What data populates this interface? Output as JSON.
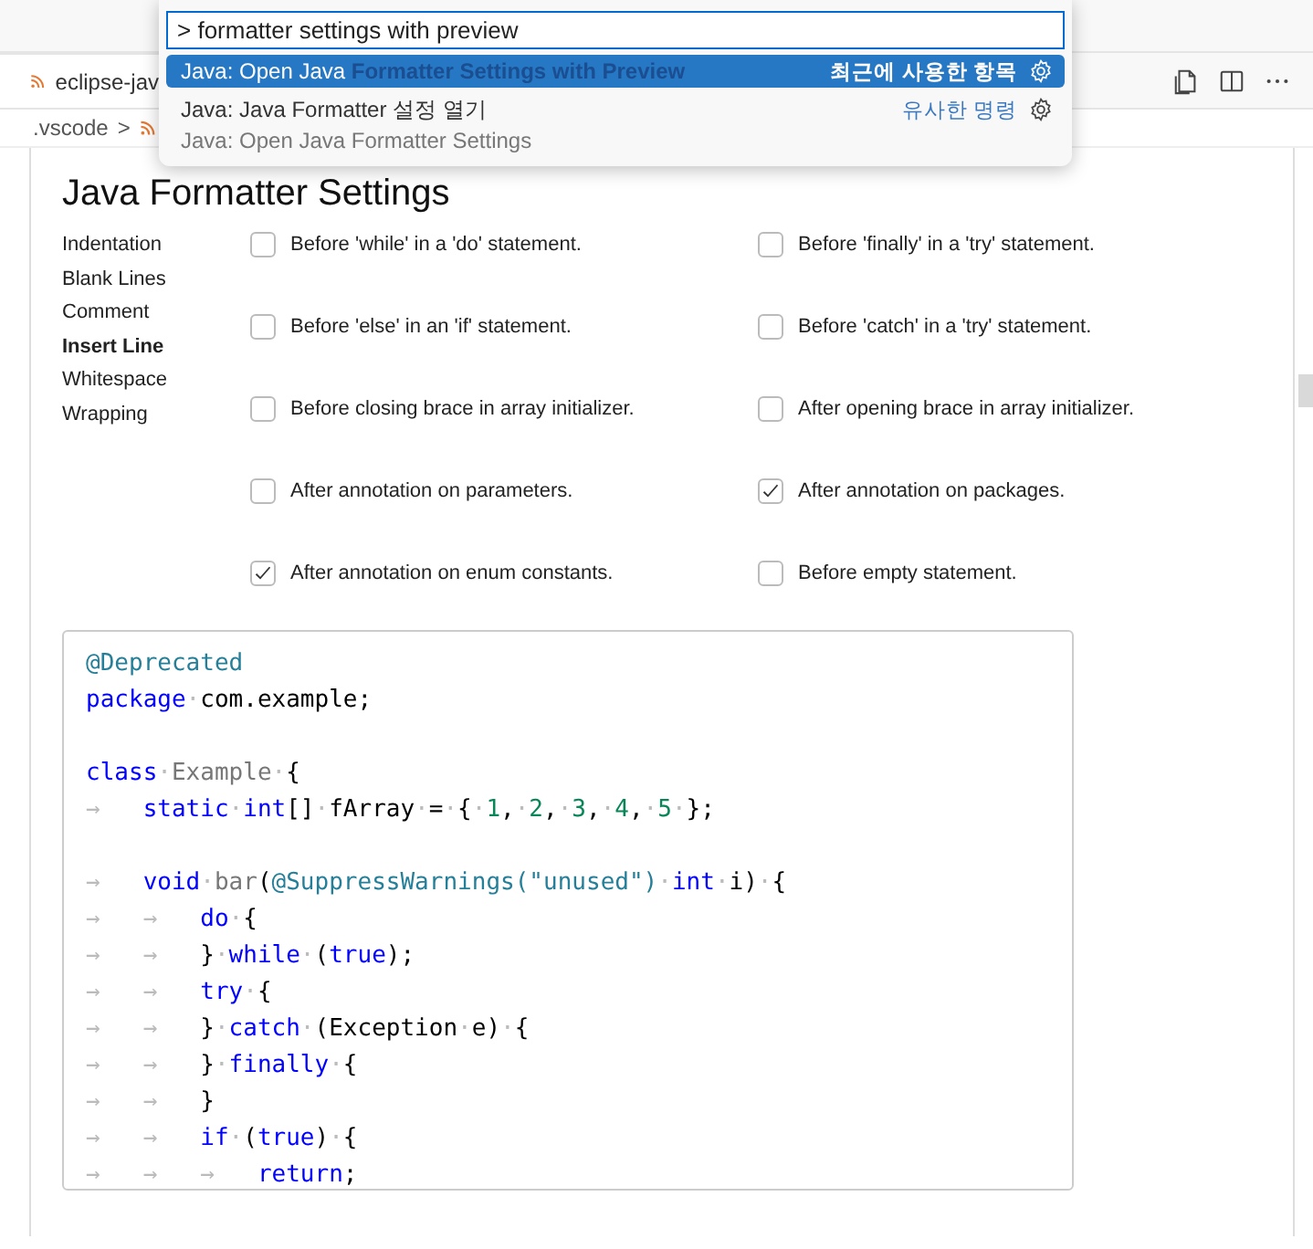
{
  "tab": {
    "title": "eclipse-jav"
  },
  "breadcrumb": {
    "folder": ".vscode",
    "separator": ">"
  },
  "palette": {
    "value": "> formatter settings with preview",
    "items": [
      {
        "label": "Java: Open Java **Formatter Settings with Preview**",
        "tag": "최근에 사용한 항목",
        "selected": true
      },
      {
        "label": "Java: Java Formatter 설정 열기",
        "tag": "유사한 명령",
        "detail": "Java: Open Java Formatter Settings",
        "selected": false
      }
    ]
  },
  "page": {
    "title": "Java Formatter Settings",
    "sections": [
      {
        "label": "Indentation",
        "selected": false
      },
      {
        "label": "Blank Lines",
        "selected": false
      },
      {
        "label": "Comment",
        "selected": false
      },
      {
        "label": "Insert Line",
        "selected": true
      },
      {
        "label": "Whitespace",
        "selected": false
      },
      {
        "label": "Wrapping",
        "selected": false
      }
    ],
    "options": [
      {
        "label": "Before 'while' in a 'do' statement.",
        "checked": false
      },
      {
        "label": "Before 'finally' in a 'try' statement.",
        "checked": false
      },
      {
        "label": "Before 'else' in an 'if' statement.",
        "checked": false
      },
      {
        "label": "Before 'catch' in a 'try' statement.",
        "checked": false
      },
      {
        "label": "Before closing brace in array initializer.",
        "checked": false
      },
      {
        "label": "After opening brace in array initializer.",
        "checked": false
      },
      {
        "label": "After annotation on parameters.",
        "checked": false
      },
      {
        "label": "After annotation on packages.",
        "checked": true
      },
      {
        "label": "After annotation on enum constants.",
        "checked": true
      },
      {
        "label": "Before empty statement.",
        "checked": false
      }
    ],
    "preview": [
      {
        "kind": "code",
        "tokens": [
          {
            "kind": "annotation",
            "text": "@Deprecated"
          }
        ]
      },
      {
        "kind": "code",
        "tokens": [
          {
            "kind": "keyword",
            "text": "package"
          },
          {
            "kind": "plain",
            "text": "·com.example;"
          }
        ]
      },
      {
        "kind": "blank"
      },
      {
        "kind": "code",
        "tokens": [
          {
            "kind": "keyword",
            "text": "class"
          },
          {
            "kind": "plain",
            "text": "·"
          },
          {
            "kind": "name",
            "text": "Example"
          },
          {
            "kind": "plain",
            "text": "·{"
          }
        ]
      },
      {
        "kind": "code",
        "tokens": [
          {
            "kind": "plain",
            "text": "→   "
          },
          {
            "kind": "keyword",
            "text": "static"
          },
          {
            "kind": "plain",
            "text": "·"
          },
          {
            "kind": "keyword",
            "text": "int"
          },
          {
            "kind": "plain",
            "text": "[]·fArray·=·{·"
          },
          {
            "kind": "number",
            "text": "1"
          },
          {
            "kind": "plain",
            "text": ",·"
          },
          {
            "kind": "number",
            "text": "2"
          },
          {
            "kind": "plain",
            "text": ",·"
          },
          {
            "kind": "number",
            "text": "3"
          },
          {
            "kind": "plain",
            "text": ",·"
          },
          {
            "kind": "number",
            "text": "4"
          },
          {
            "kind": "plain",
            "text": ",·"
          },
          {
            "kind": "number",
            "text": "5"
          },
          {
            "kind": "plain",
            "text": "·};"
          }
        ]
      },
      {
        "kind": "blank"
      },
      {
        "kind": "code",
        "tokens": [
          {
            "kind": "plain",
            "text": "→   "
          },
          {
            "kind": "keyword",
            "text": "void"
          },
          {
            "kind": "plain",
            "text": "·"
          },
          {
            "kind": "name",
            "text": "bar"
          },
          {
            "kind": "plain",
            "text": "("
          },
          {
            "kind": "annotation",
            "text": "@SuppressWarnings(\"unused\")"
          },
          {
            "kind": "plain",
            "text": "·"
          },
          {
            "kind": "keyword",
            "text": "int"
          },
          {
            "kind": "plain",
            "text": "·i)·{"
          }
        ]
      },
      {
        "kind": "code",
        "tokens": [
          {
            "kind": "plain",
            "text": "→   →   "
          },
          {
            "kind": "keyword",
            "text": "do"
          },
          {
            "kind": "plain",
            "text": "·{"
          }
        ]
      },
      {
        "kind": "code",
        "tokens": [
          {
            "kind": "plain",
            "text": "→   →   }·"
          },
          {
            "kind": "keyword",
            "text": "while"
          },
          {
            "kind": "plain",
            "text": "·("
          },
          {
            "kind": "keyword",
            "text": "true"
          },
          {
            "kind": "plain",
            "text": ");"
          }
        ]
      },
      {
        "kind": "code",
        "tokens": [
          {
            "kind": "plain",
            "text": "→   →   "
          },
          {
            "kind": "keyword",
            "text": "try"
          },
          {
            "kind": "plain",
            "text": "·{"
          }
        ]
      },
      {
        "kind": "code",
        "tokens": [
          {
            "kind": "plain",
            "text": "→   →   }·"
          },
          {
            "kind": "keyword",
            "text": "catch"
          },
          {
            "kind": "plain",
            "text": "·(Exception·e)·{"
          }
        ]
      },
      {
        "kind": "code",
        "tokens": [
          {
            "kind": "plain",
            "text": "→   →   }·"
          },
          {
            "kind": "keyword",
            "text": "finally"
          },
          {
            "kind": "plain",
            "text": "·{"
          }
        ]
      },
      {
        "kind": "code",
        "tokens": [
          {
            "kind": "plain",
            "text": "→   →   }"
          }
        ]
      },
      {
        "kind": "code",
        "tokens": [
          {
            "kind": "plain",
            "text": "→   →   "
          },
          {
            "kind": "keyword",
            "text": "if"
          },
          {
            "kind": "plain",
            "text": "·("
          },
          {
            "kind": "keyword",
            "text": "true"
          },
          {
            "kind": "plain",
            "text": ")·{"
          }
        ]
      },
      {
        "kind": "code",
        "tokens": [
          {
            "kind": "plain",
            "text": "→   →   →   "
          },
          {
            "kind": "keyword",
            "text": "return"
          },
          {
            "kind": "plain",
            "text": ";"
          }
        ]
      }
    ]
  }
}
